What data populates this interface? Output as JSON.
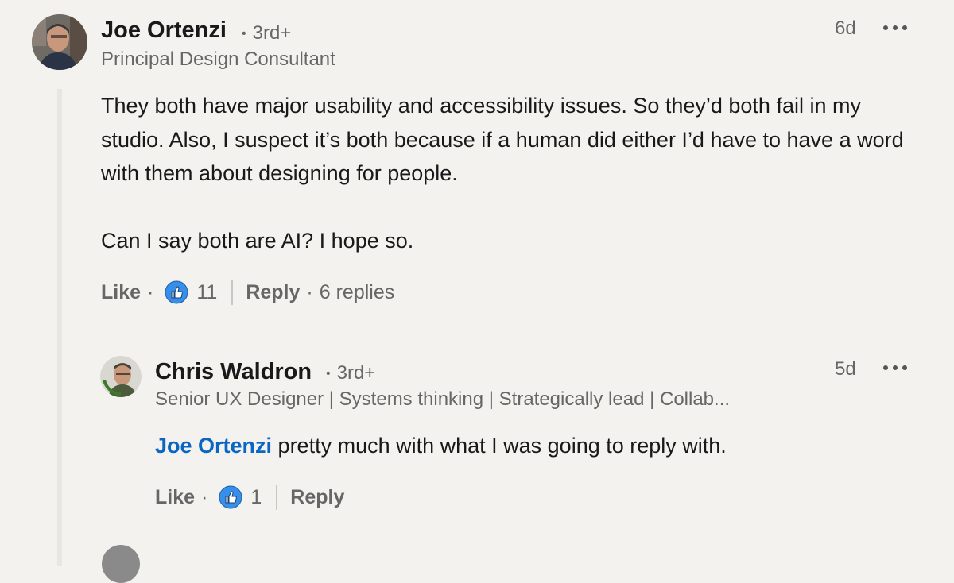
{
  "comments": [
    {
      "author": "Joe Ortenzi",
      "degree_sep": "•",
      "degree": "3rd+",
      "headline": "Principal Design Consultant",
      "time": "6d",
      "paragraphs": [
        "They both have major usability and accessibility issues. So they’d both fail in my studio. Also, I suspect it’s both because if a human did either I’d have to have a word with them about designing for people.",
        "Can I say both are AI? I hope so."
      ],
      "actions": {
        "like_label": "Like",
        "dot": "·",
        "like_count": "11",
        "reply_label": "Reply",
        "replies_text": "6 replies"
      }
    },
    {
      "author": "Chris Waldron",
      "degree_sep": "•",
      "degree": "3rd+",
      "headline": "Senior UX Designer | Systems thinking | Strategically lead | Collab...",
      "time": "5d",
      "mention": "Joe Ortenzi",
      "text": " pretty much with what I was going to reply with.",
      "actions": {
        "like_label": "Like",
        "dot": "·",
        "like_count": "1",
        "reply_label": "Reply"
      }
    }
  ],
  "icons": {
    "more": "more-options-icon",
    "like": "like-reaction-icon"
  },
  "colors": {
    "background": "#f4f2ee",
    "link": "#0a66c2",
    "like_blue": "#378fe9"
  }
}
